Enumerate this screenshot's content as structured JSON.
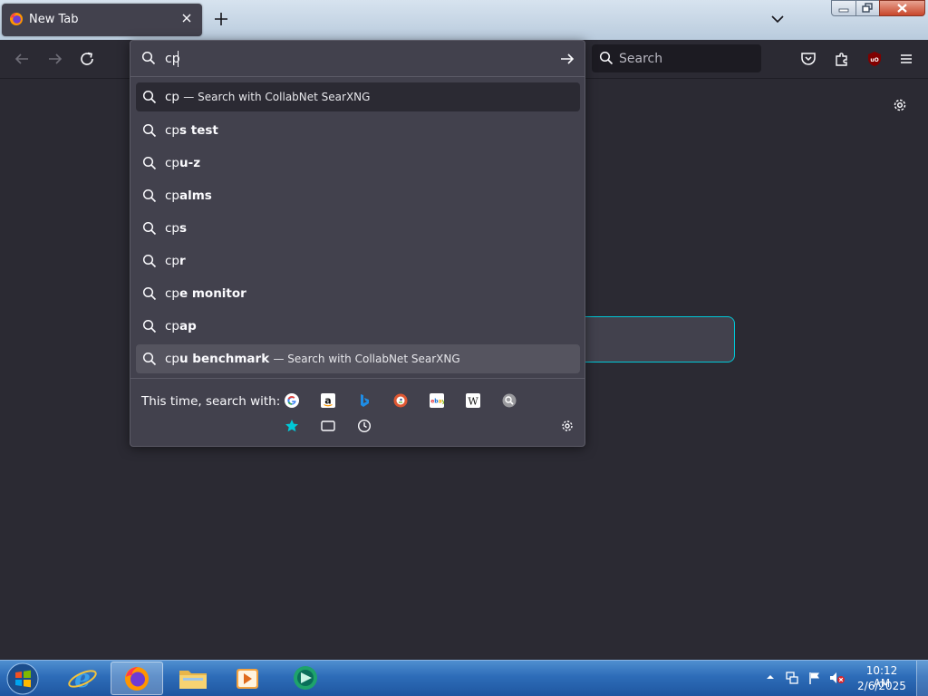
{
  "browser": {
    "tab": {
      "title": "New Tab"
    },
    "nav": {
      "search_placeholder": "Search"
    },
    "urlbar": {
      "value": "cp",
      "heuristic": {
        "typed": "cp",
        "action": "— Search with CollabNet SearXNG"
      },
      "suggestions": [
        {
          "typed": "cp",
          "completion": "s test"
        },
        {
          "typed": "cp",
          "completion": "u-z"
        },
        {
          "typed": "cp",
          "completion": "alms"
        },
        {
          "typed": "cp",
          "completion": "s"
        },
        {
          "typed": "cp",
          "completion": "r"
        },
        {
          "typed": "cp",
          "completion": "e monitor"
        },
        {
          "typed": "cp",
          "completion": "ap"
        }
      ],
      "hovered": {
        "typed": "cp",
        "completion": "u benchmark",
        "action": "— Search with CollabNet SearXNG"
      },
      "one_off_label": "This time, search with:",
      "one_off_engines": [
        "google-icon",
        "amazon-icon",
        "bing-icon",
        "duckduckgo-icon",
        "ebay-icon",
        "wikipedia-icon",
        "searxng-icon",
        "bookmarks-icon",
        "tabs-icon",
        "history-icon"
      ]
    }
  },
  "taskbar": {
    "items": [
      "internet-explorer-icon",
      "firefox-icon",
      "file-explorer-icon",
      "media-player-icon",
      "app-icon"
    ],
    "clock": {
      "time": "10:12 AM",
      "date": "2/6/2025"
    }
  },
  "colors": {
    "toolbar_bg": "#2b2a33",
    "popup_bg": "#42414d",
    "accent": "#00c8d7",
    "taskbar": "#2d6cb8"
  }
}
